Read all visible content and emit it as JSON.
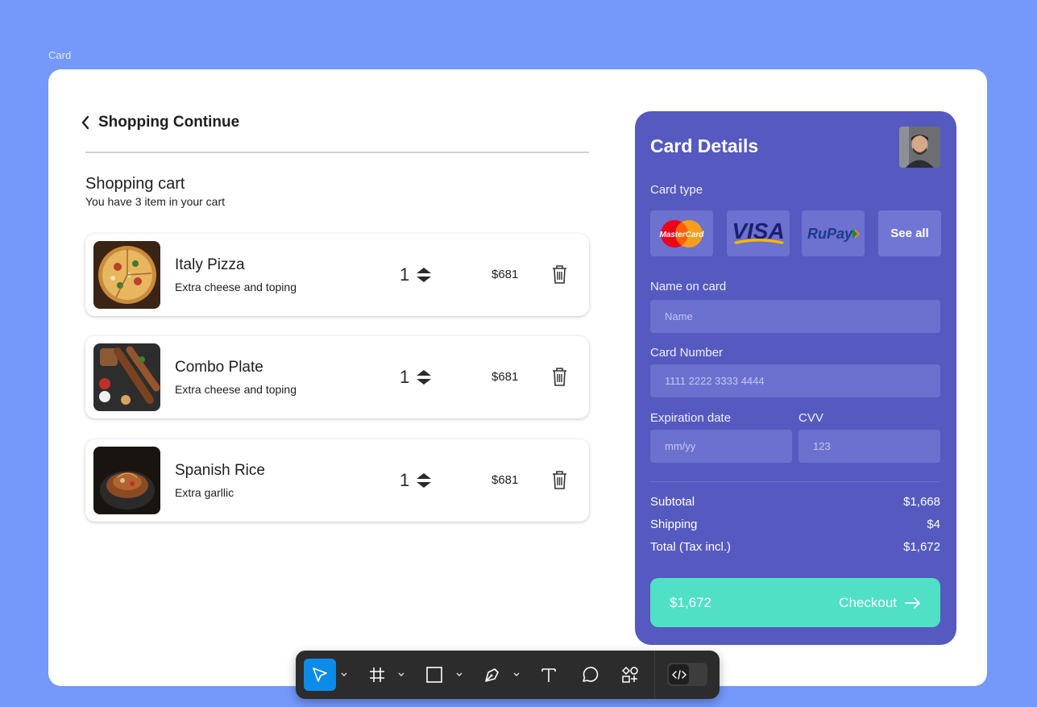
{
  "frame_label": "Card",
  "header": {
    "back_label": "Shopping Continue"
  },
  "cart": {
    "title": "Shopping cart",
    "subtitle": "You have 3 item in your cart",
    "items": [
      {
        "name": "Italy Pizza",
        "desc": "Extra cheese and toping",
        "qty": "1",
        "price": "$681"
      },
      {
        "name": "Combo Plate",
        "desc": "Extra cheese and toping",
        "qty": "1",
        "price": "$681"
      },
      {
        "name": "Spanish Rice",
        "desc": "Extra garllic",
        "qty": "1",
        "price": "$681"
      }
    ]
  },
  "payment": {
    "title": "Card Details",
    "card_type_label": "Card type",
    "card_types": [
      "MasterCard",
      "VISA",
      "RuPay"
    ],
    "see_all": "See all",
    "name_label": "Name on card",
    "name_placeholder": "Name",
    "number_label": "Card Number",
    "number_placeholder": "1111 2222 3333 4444",
    "exp_label": "Expiration date",
    "exp_placeholder": "mm/yy",
    "cvv_label": "CVV",
    "cvv_placeholder": "123",
    "subtotal_label": "Subtotal",
    "subtotal_value": "$1,668",
    "shipping_label": "Shipping",
    "shipping_value": "$4",
    "total_label": "Total (Tax incl.)",
    "total_value": "$1,672",
    "checkout_amount": "$1,672",
    "checkout_label": "Checkout"
  },
  "colors": {
    "background": "#7499fb",
    "panel": "#5659bf",
    "checkout": "#4fe0c6",
    "toolbar": "#2c2c2c",
    "active_tool": "#0c8ce9"
  },
  "toolbar": {
    "tools": [
      "move-tool-icon",
      "frame-tool-icon",
      "rectangle-tool-icon",
      "pen-tool-icon",
      "text-tool-icon",
      "comment-tool-icon",
      "actions-tool-icon",
      "dev-mode-icon"
    ]
  }
}
